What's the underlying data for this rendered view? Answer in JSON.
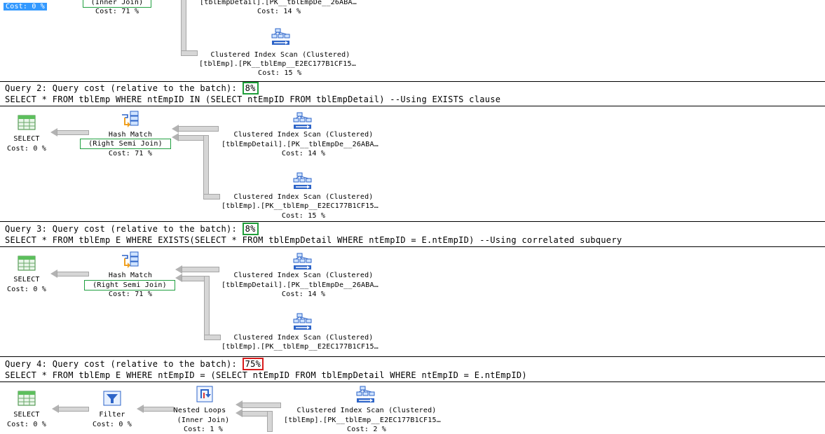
{
  "q1_partial": {
    "select_cost": "Cost: 0 %",
    "hash_join_type": "(Inner Join)",
    "hash_cost": "Cost: 71 %",
    "top_scan_object": "[tblEmpDetail].[PK__tblEmpDe__26ABA…",
    "top_scan_cost": "Cost: 14 %",
    "bottom_scan_title": "Clustered Index Scan (Clustered)",
    "bottom_scan_object": "[tblEmp].[PK__tblEmp__E2EC177B1CF15…",
    "bottom_scan_cost": "Cost: 15 %"
  },
  "queries": [
    {
      "header_prefix": "Query 2: Query cost (relative to the batch): ",
      "pct": "8%",
      "pct_status": "green",
      "sql": "SELECT * FROM tblEmp WHERE ntEmpID IN (SELECT ntEmpID FROM tblEmpDetail) --Using EXISTS clause",
      "select_title": "SELECT",
      "select_cost": "Cost: 0 %",
      "hash_title": "Hash Match",
      "hash_join_type": "(Right Semi Join)",
      "hash_cost": "Cost: 71 %",
      "scan1_title": "Clustered Index Scan (Clustered)",
      "scan1_object": "[tblEmpDetail].[PK__tblEmpDe__26ABA…",
      "scan1_cost": "Cost: 14 %",
      "scan2_title": "Clustered Index Scan (Clustered)",
      "scan2_object": "[tblEmp].[PK__tblEmp__E2EC177B1CF15…",
      "scan2_cost": "Cost: 15 %"
    },
    {
      "header_prefix": "Query 3: Query cost (relative to the batch): ",
      "pct": "8%",
      "pct_status": "green",
      "sql": "SELECT * FROM tblEmp E WHERE EXISTS(SELECT * FROM tblEmpDetail WHERE ntEmpID = E.ntEmpID) --Using correlated subquery",
      "select_title": "SELECT",
      "select_cost": "Cost: 0 %",
      "hash_title": "Hash Match",
      "hash_join_type": "(Right Semi Join)",
      "hash_cost": "Cost: 71 %",
      "scan1_title": "Clustered Index Scan (Clustered)",
      "scan1_object": "[tblEmpDetail].[PK__tblEmpDe__26ABA…",
      "scan1_cost": "Cost: 14 %",
      "scan2_title": "Clustered Index Scan (Clustered)",
      "scan2_object": "[tblEmp].[PK__tblEmp__E2EC177B1CF15…"
    },
    {
      "header_prefix": "Query 4: Query cost (relative to the batch): ",
      "pct": "75%",
      "pct_status": "red",
      "sql": "SELECT * FROM tblEmp E WHERE ntEmpID = (SELECT ntEmpID FROM tblEmpDetail WHERE ntEmpID = E.ntEmpID)",
      "select_title": "SELECT",
      "select_cost": "Cost: 0 %",
      "filter_title": "Filter",
      "filter_cost": "Cost: 0 %",
      "loops_title": "Nested Loops",
      "loops_join_type": "(Inner Join)",
      "loops_cost": "Cost: 1 %",
      "scan1_title": "Clustered Index Scan (Clustered)",
      "scan1_object": "[tblEmp].[PK__tblEmp__E2EC177B1CF15…",
      "scan1_cost": "Cost: 2 %"
    }
  ],
  "icons": {
    "select": "select-result-icon",
    "hash_match": "hash-match-icon",
    "index_scan": "clustered-index-scan-icon",
    "filter": "filter-icon",
    "nested_loops": "nested-loops-icon"
  },
  "colors": {
    "pct_green": "#1f9e3a",
    "pct_red": "#d81c1c",
    "selection": "#3399ff"
  }
}
